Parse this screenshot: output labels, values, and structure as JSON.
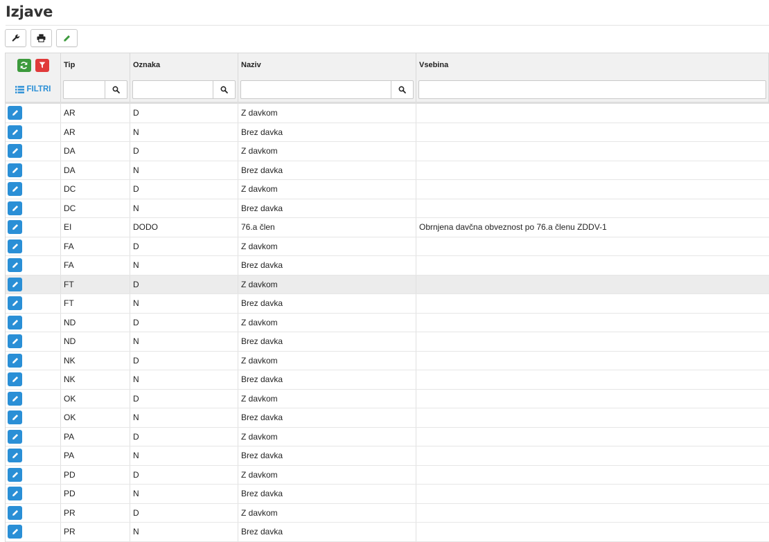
{
  "page": {
    "title": "Izjave"
  },
  "toolbar": {
    "buttons": [
      {
        "name": "settings-button",
        "icon": "wrench-icon"
      },
      {
        "name": "print-button",
        "icon": "print-icon"
      },
      {
        "name": "edit-button",
        "icon": "pencil-icon"
      }
    ]
  },
  "grid": {
    "columns": [
      "Tip",
      "Oznaka",
      "Naziv",
      "Vsebina"
    ],
    "filter_label": "FILTRI",
    "filters": {
      "tip": "",
      "oznaka": "",
      "naziv": "",
      "vsebina": ""
    },
    "rows": [
      {
        "tip": "AR",
        "oznaka": "D",
        "naziv": "Z davkom",
        "vsebina": ""
      },
      {
        "tip": "AR",
        "oznaka": "N",
        "naziv": "Brez davka",
        "vsebina": ""
      },
      {
        "tip": "DA",
        "oznaka": "D",
        "naziv": "Z davkom",
        "vsebina": ""
      },
      {
        "tip": "DA",
        "oznaka": "N",
        "naziv": "Brez davka",
        "vsebina": ""
      },
      {
        "tip": "DC",
        "oznaka": "D",
        "naziv": "Z davkom",
        "vsebina": ""
      },
      {
        "tip": "DC",
        "oznaka": "N",
        "naziv": "Brez davka",
        "vsebina": ""
      },
      {
        "tip": "EI",
        "oznaka": "DODO",
        "naziv": "76.a člen",
        "vsebina": "Obrnjena davčna obveznost po 76.a členu ZDDV-1"
      },
      {
        "tip": "FA",
        "oznaka": "D",
        "naziv": "Z davkom",
        "vsebina": ""
      },
      {
        "tip": "FA",
        "oznaka": "N",
        "naziv": "Brez davka",
        "vsebina": ""
      },
      {
        "tip": "FT",
        "oznaka": "D",
        "naziv": "Z davkom",
        "vsebina": "",
        "highlighted": true
      },
      {
        "tip": "FT",
        "oznaka": "N",
        "naziv": "Brez davka",
        "vsebina": ""
      },
      {
        "tip": "ND",
        "oznaka": "D",
        "naziv": "Z davkom",
        "vsebina": ""
      },
      {
        "tip": "ND",
        "oznaka": "N",
        "naziv": "Brez davka",
        "vsebina": ""
      },
      {
        "tip": "NK",
        "oznaka": "D",
        "naziv": "Z davkom",
        "vsebina": ""
      },
      {
        "tip": "NK",
        "oznaka": "N",
        "naziv": "Brez davka",
        "vsebina": ""
      },
      {
        "tip": "OK",
        "oznaka": "D",
        "naziv": "Z davkom",
        "vsebina": ""
      },
      {
        "tip": "OK",
        "oznaka": "N",
        "naziv": "Brez davka",
        "vsebina": ""
      },
      {
        "tip": "PA",
        "oznaka": "D",
        "naziv": "Z davkom",
        "vsebina": ""
      },
      {
        "tip": "PA",
        "oznaka": "N",
        "naziv": "Brez davka",
        "vsebina": ""
      },
      {
        "tip": "PD",
        "oznaka": "D",
        "naziv": "Z davkom",
        "vsebina": ""
      },
      {
        "tip": "PD",
        "oznaka": "N",
        "naziv": "Brez davka",
        "vsebina": ""
      },
      {
        "tip": "PR",
        "oznaka": "D",
        "naziv": "Z davkom",
        "vsebina": ""
      },
      {
        "tip": "PR",
        "oznaka": "N",
        "naziv": "Brez davka",
        "vsebina": ""
      }
    ]
  },
  "colors": {
    "accent": "#2a8fd6",
    "refresh": "#3c9a3c",
    "filter": "#e03a3a",
    "edit_green": "#3c9a3c"
  }
}
